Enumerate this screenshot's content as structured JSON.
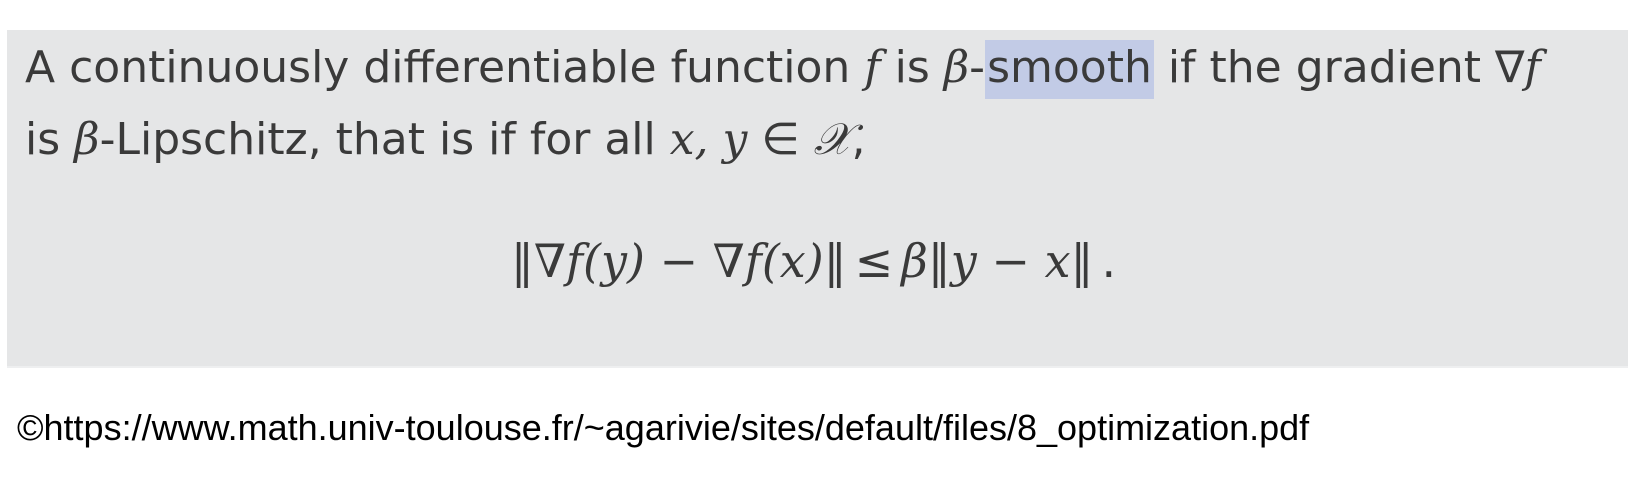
{
  "definition": {
    "line1": {
      "t1": "A continuously differentiable function ",
      "f": "f",
      "t2": " is ",
      "beta": "β",
      "dash": "-",
      "highlighted": "smooth",
      "t3": " if the gradient ",
      "nabla": "∇",
      "f2": "f"
    },
    "line2": {
      "t1": "is ",
      "beta": "β",
      "t2": "-Lipschitz, that is if for all ",
      "vars": "x, y",
      "in": " ∈ ",
      "set": "𝒳",
      "comma": ","
    },
    "equation": {
      "lhs": "‖∇f(y) − ∇f(x)‖",
      "rel": "≤",
      "rhs": "β‖y − x‖",
      "end": "."
    }
  },
  "credit": "©https://www.math.univ-toulouse.fr/~agarivie/sites/default/files/8_optimization.pdf",
  "colors": {
    "box_background": "#e5e6e7",
    "highlight": "#c2cbe6",
    "text": "#3a3a3a"
  }
}
